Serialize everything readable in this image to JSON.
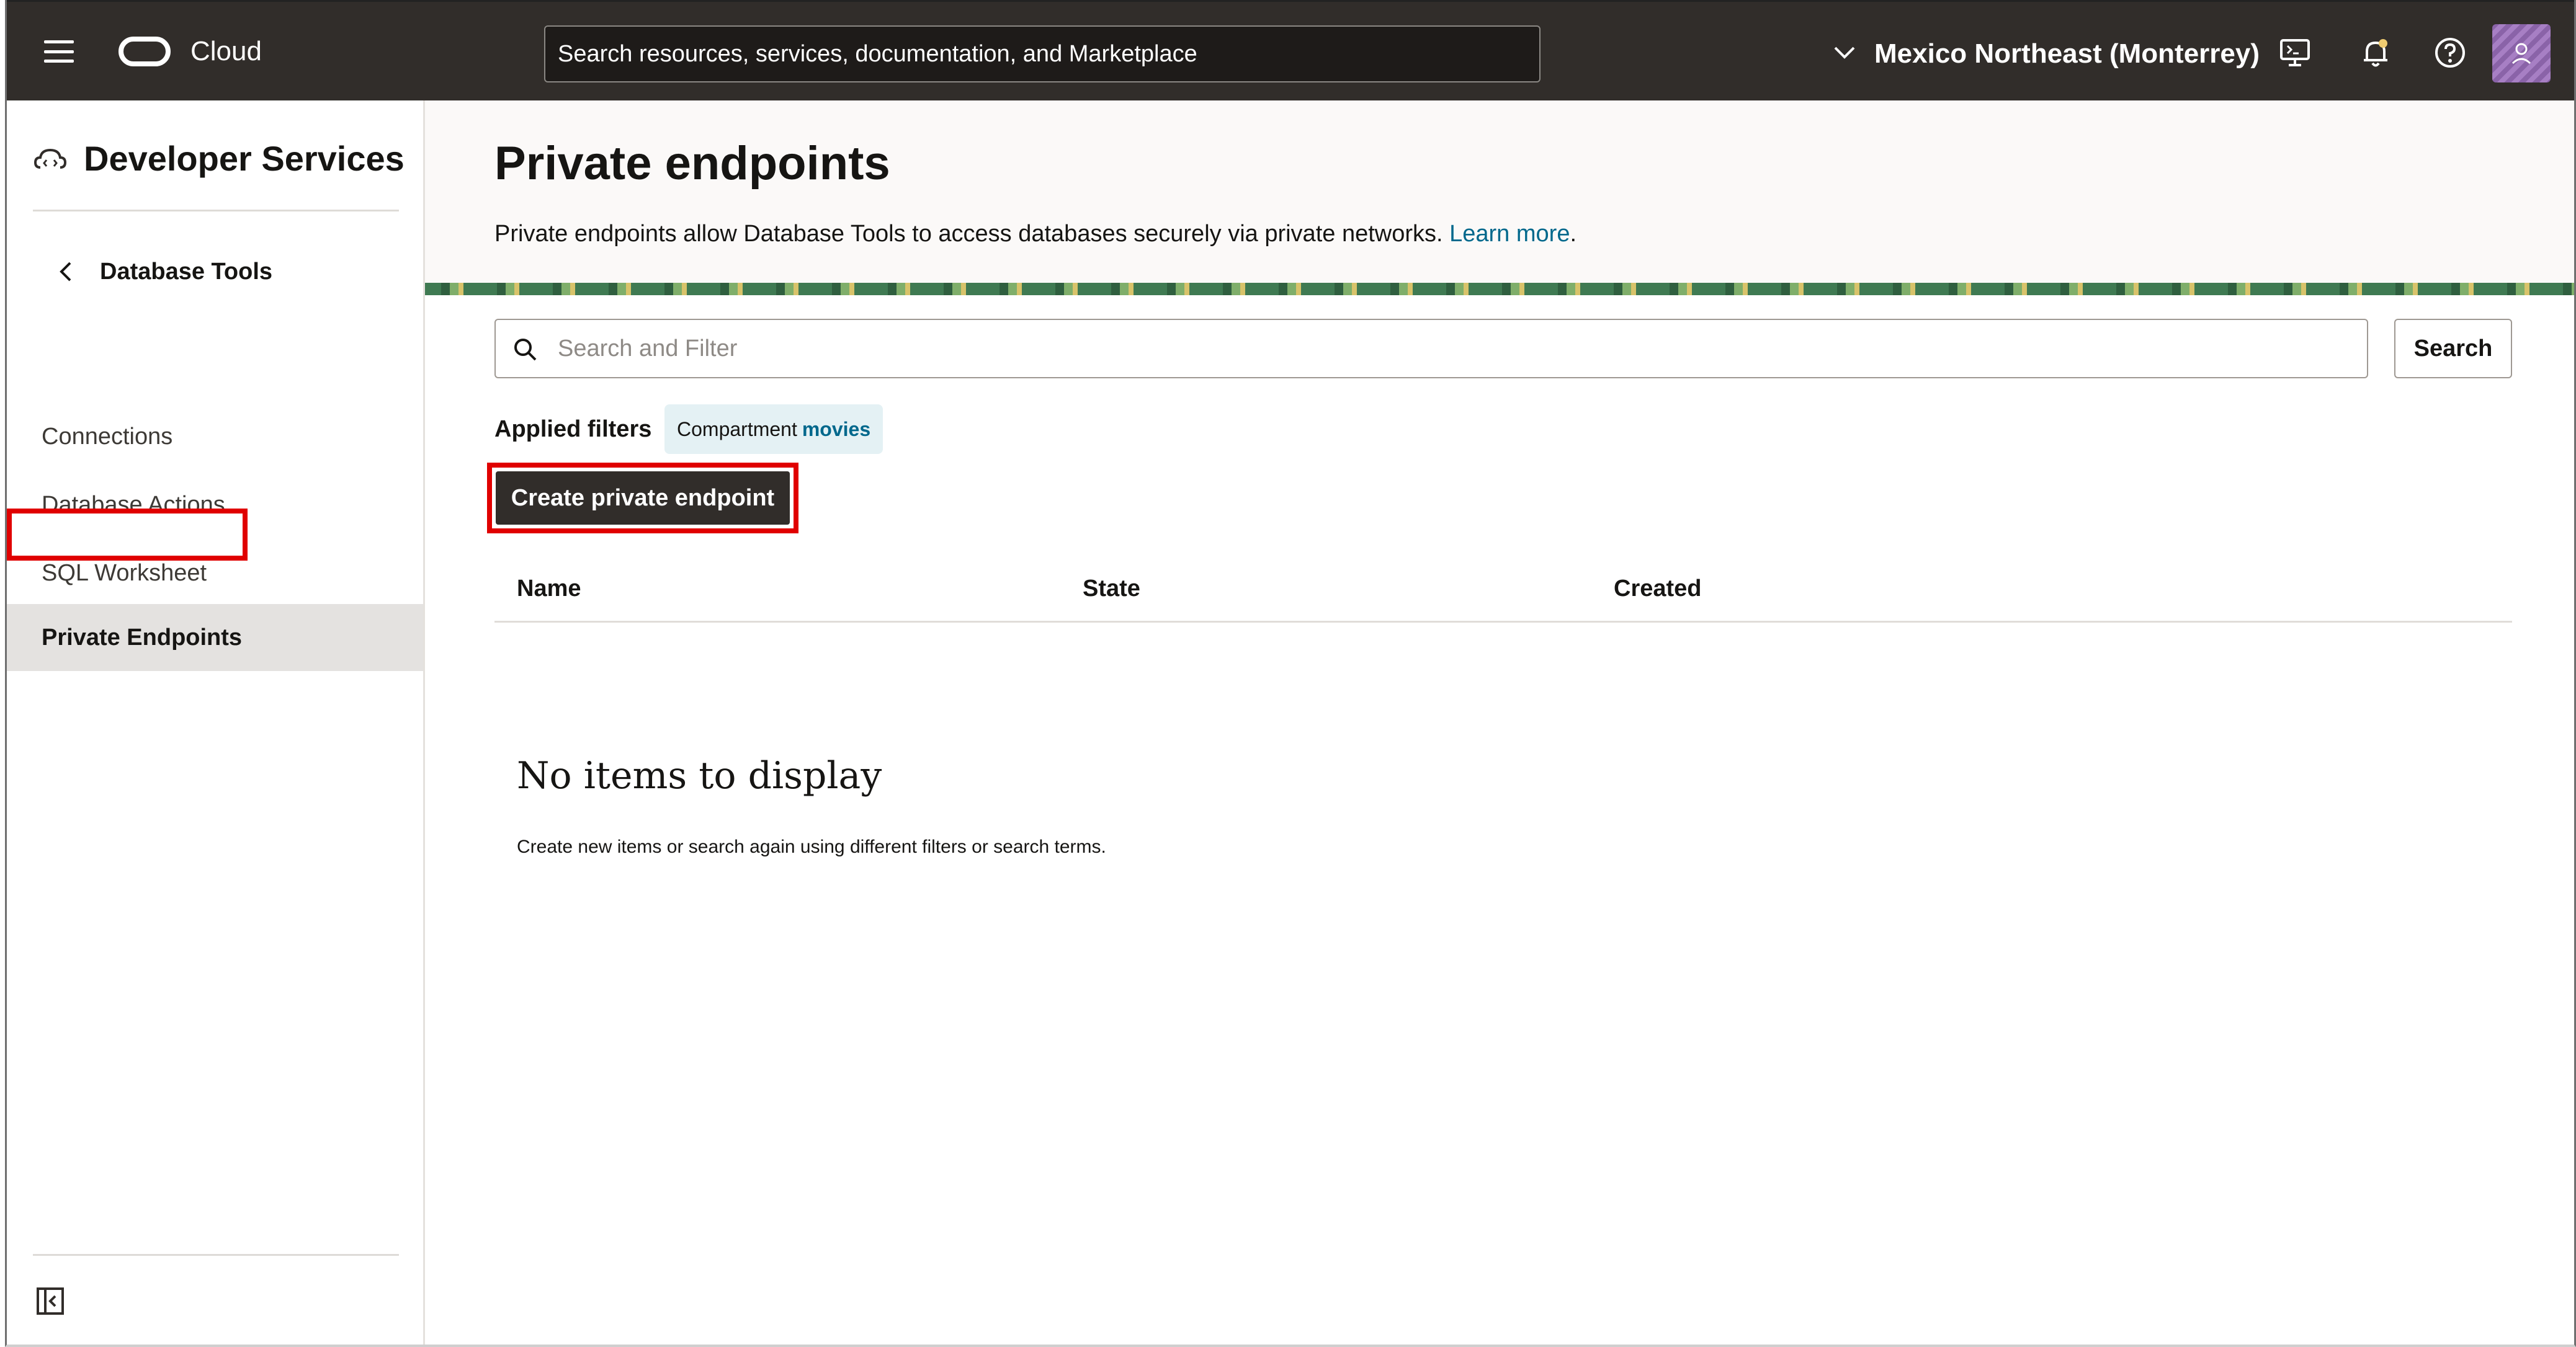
{
  "header": {
    "brand": "Cloud",
    "search_placeholder": "Search resources, services, documentation, and Marketplace",
    "region": "Mexico Northeast (Monterrey)"
  },
  "sidebar": {
    "title": "Developer Services",
    "section": "Database Tools",
    "items": [
      {
        "label": "Connections",
        "selected": false
      },
      {
        "label": "Database Actions",
        "selected": false
      },
      {
        "label": "SQL Worksheet",
        "selected": false
      },
      {
        "label": "Private Endpoints",
        "selected": true
      }
    ]
  },
  "main": {
    "title": "Private endpoints",
    "description": "Private endpoints allow Database Tools to access databases securely via private networks.",
    "learn_more": "Learn more",
    "filter_placeholder": "Search and Filter",
    "search_label": "Search",
    "applied_filters_label": "Applied filters",
    "filter_chip": {
      "name": "Compartment",
      "value": "movies"
    },
    "create_button": "Create private endpoint",
    "table_columns": [
      "Name",
      "State",
      "Created"
    ],
    "empty_title": "No items to display",
    "empty_message": "Create new items or search again using different filters or search terms."
  },
  "colors": {
    "header_bg": "#312d2a",
    "highlight": "#e00000",
    "link": "#00688c",
    "selected_item_bg": "#e4e2e0"
  }
}
